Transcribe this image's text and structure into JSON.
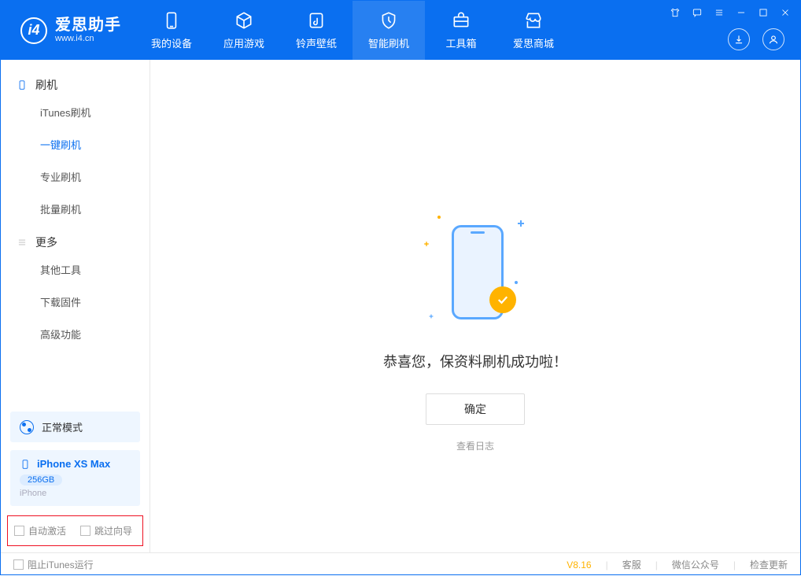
{
  "app": {
    "name_cn": "爱思助手",
    "name_en": "www.i4.cn"
  },
  "nav": {
    "device": "我的设备",
    "apps": "应用游戏",
    "ring": "铃声壁纸",
    "flash": "智能刷机",
    "tools": "工具箱",
    "store": "爱思商城"
  },
  "sidebar": {
    "group_flash": "刷机",
    "itunes_flash": "iTunes刷机",
    "one_click": "一键刷机",
    "pro_flash": "专业刷机",
    "batch_flash": "批量刷机",
    "group_more": "更多",
    "other_tools": "其他工具",
    "download_fw": "下载固件",
    "advanced": "高级功能"
  },
  "mode": {
    "label": "正常模式"
  },
  "device": {
    "name": "iPhone XS Max",
    "storage": "256GB",
    "type": "iPhone"
  },
  "checks": {
    "auto_activate": "自动激活",
    "skip_guide": "跳过向导"
  },
  "main": {
    "success": "恭喜您，保资料刷机成功啦！",
    "ok": "确定",
    "view_log": "查看日志"
  },
  "footer": {
    "block_itunes": "阻止iTunes运行",
    "version": "V8.16",
    "service": "客服",
    "wechat": "微信公众号",
    "update": "检查更新"
  }
}
